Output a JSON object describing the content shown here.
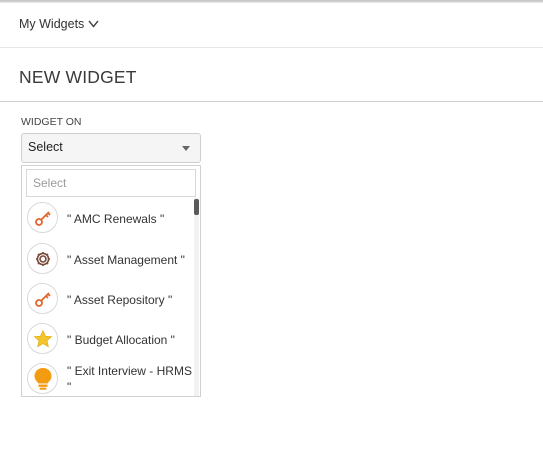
{
  "header": {
    "my_widgets_label": "My Widgets"
  },
  "page": {
    "title": "NEW WIDGET"
  },
  "form": {
    "widget_on_label": "WIDGET ON",
    "select_value": "Select",
    "search_placeholder": "Select"
  },
  "dropdown": {
    "items": [
      {
        "label": "\" AMC Renewals \"",
        "icon": "key-icon"
      },
      {
        "label": "\" Asset Management \"",
        "icon": "gear-icon"
      },
      {
        "label": "\" Asset Repository \"",
        "icon": "key-icon"
      },
      {
        "label": "\" Budget Allocation \"",
        "icon": "star-icon"
      },
      {
        "label": "\" Exit Interview - HRMS \"",
        "icon": "lightbulb-icon"
      }
    ]
  },
  "colors": {
    "key": "#e0662b",
    "star": "#f4c430",
    "bulb": "#f39c12",
    "gear": "#7a4a3a"
  }
}
